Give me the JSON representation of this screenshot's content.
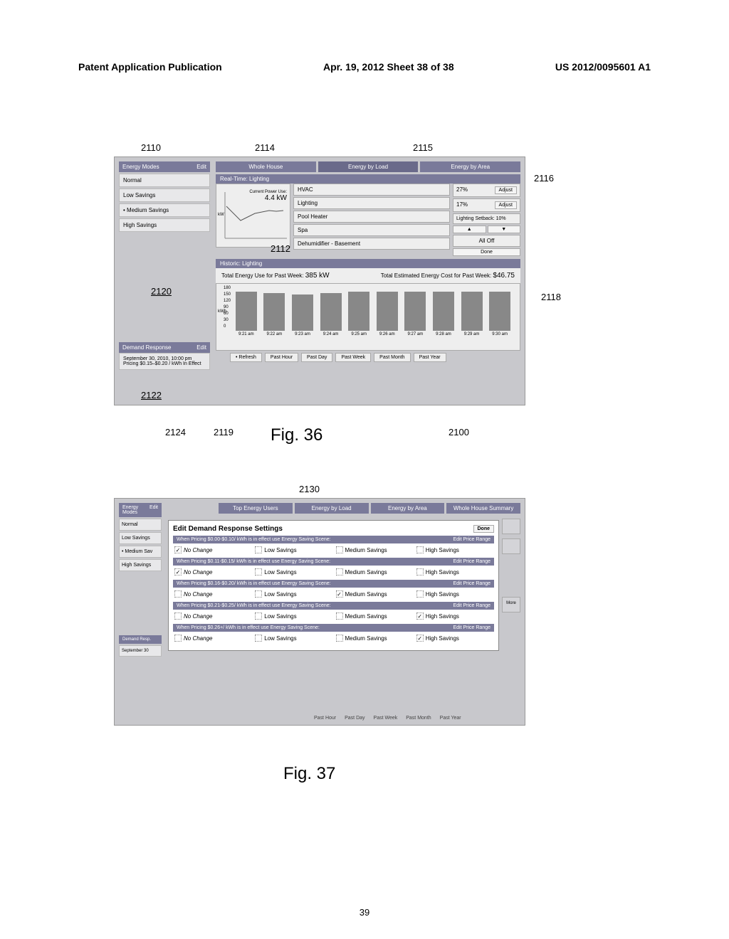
{
  "header": {
    "left": "Patent Application Publication",
    "center": "Apr. 19, 2012  Sheet 38 of 38",
    "right": "US 2012/0095601 A1"
  },
  "fig36": {
    "caption": "Fig. 36",
    "leaders": {
      "l2110": "2110",
      "l2114": "2114",
      "l2115": "2115",
      "l2116": "2116",
      "l2112": "2112",
      "l2118": "2118",
      "l2119": "2119",
      "l2120": "2120",
      "l2122": "2122",
      "l2124": "2124",
      "l2100": "2100"
    },
    "energy_modes": {
      "title": "Energy Modes",
      "edit": "Edit",
      "items": [
        "Normal",
        "Low Savings",
        "• Medium Savings",
        "High Savings"
      ]
    },
    "tabs": [
      "Whole House",
      "Energy by Load",
      "Energy by Area"
    ],
    "realtime": {
      "title": "Real-Time: Lighting",
      "label": "Current Power Use:",
      "value": "4.4 kW",
      "yunit": "kW"
    },
    "loads": [
      "HVAC",
      "Lighting",
      "Pool Heater",
      "Spa",
      "Dehumidifier - Basement"
    ],
    "adjust": {
      "r1_pct": "27%",
      "r1_btn": "Adjust",
      "r2_pct": "17%",
      "r2_btn": "Adjust",
      "setback": "Lighting Setback: 10%",
      "alloff": "All Off",
      "done": "Done"
    },
    "historic": {
      "title": "Historic: Lighting",
      "use_label": "Total Energy Use for Past Week:",
      "use_val": "385 kW",
      "cost_label": "Total Estimated Energy Cost for Past Week:",
      "cost_val": "$46.75",
      "ylabel": "kWh",
      "refresh": "• Refresh",
      "buttons": [
        "Past Hour",
        "Past Day",
        "Past Week",
        "Past Month",
        "Past Year"
      ]
    },
    "demand_response": {
      "title": "Demand Response",
      "edit": "Edit",
      "line1": "September 30, 2010, 10:00 pm",
      "line2": "Pricing $0.15–$0.20 / kWh In Effect"
    }
  },
  "chart_data": [
    {
      "type": "line",
      "title": "Real-Time: Lighting",
      "ylabel": "kW",
      "ylim": [
        0,
        7
      ],
      "annotation": "Current Power Use: 4.4 kW",
      "x": [
        1,
        2,
        3,
        4,
        5,
        6,
        7,
        8,
        9,
        10
      ],
      "y": [
        5,
        4,
        3,
        3.5,
        4,
        4.2,
        4.4,
        4.3,
        4.4,
        4.4
      ]
    },
    {
      "type": "bar",
      "title": "Historic: Lighting",
      "ylabel": "kWh",
      "ylim": [
        0,
        180
      ],
      "yticks": [
        0,
        30,
        60,
        90,
        120,
        150,
        180
      ],
      "categories": [
        "9:21 am",
        "9:22 am",
        "9:23 am",
        "9:24 am",
        "9:25 am",
        "9:26 am",
        "9:27 am",
        "9:28 am",
        "9:29 am",
        "9:30 am"
      ],
      "values": [
        160,
        155,
        150,
        155,
        160,
        160,
        160,
        160,
        158,
        158
      ]
    }
  ],
  "fig37": {
    "caption": "Fig. 37",
    "leader": "2130",
    "tabs": [
      "Top Energy Users",
      "Energy by Load",
      "Energy by Area",
      "Whole House Summary"
    ],
    "modes": [
      "Normal",
      "Low Savings",
      "• Medium Sav",
      "High Savings"
    ],
    "dr_label": "Demand Resp.",
    "dr_date": "September 30",
    "modal": {
      "title": "Edit Demand Response Settings",
      "done": "Done",
      "edit_range": "Edit Price Range",
      "options": [
        "No Change",
        "Low Savings",
        "Medium Savings",
        "High Savings"
      ],
      "rules": [
        {
          "text": "When Pricing $0.00-$0.10/ kWh is in effect use Energy Saving Scene:",
          "sel": 0
        },
        {
          "text": "When Pricing $0.11-$0.15/ kWh is in effect use Energy Saving Scene:",
          "sel": 0
        },
        {
          "text": "When Pricing $0.16-$0.20/ kWh is in effect use Energy Saving Scene:",
          "sel": 2
        },
        {
          "text": "When Pricing $0.21-$0.25/ kWh is in effect use Energy Saving Scene:",
          "sel": 3
        },
        {
          "text": "When Pricing $0.26+/ kWh is in effect use Energy Saving Scene:",
          "sel": 3
        }
      ]
    },
    "foot": [
      "Past Hour",
      "Past Day",
      "Past Week",
      "Past Month",
      "Past Year"
    ],
    "more": "More"
  },
  "page_number": "39"
}
